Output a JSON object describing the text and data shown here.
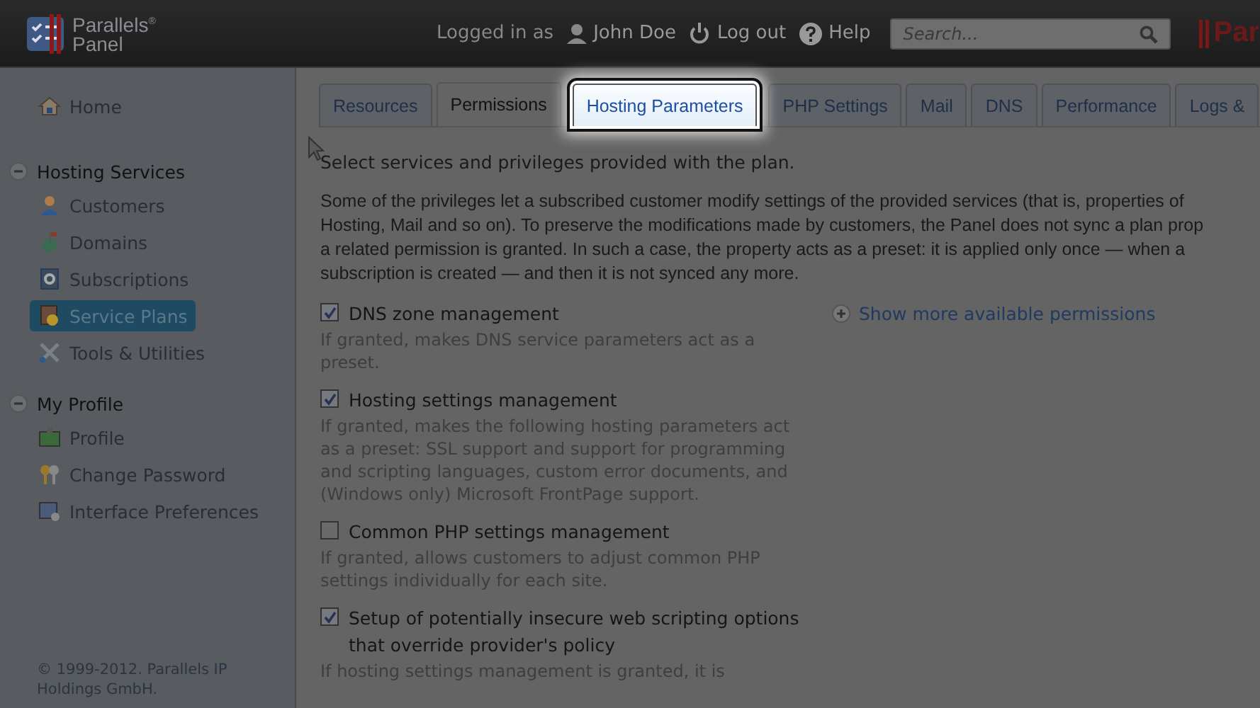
{
  "header": {
    "logo_line_1": "Parallels$^{®}$",
    "logo_line_2": "Panel",
    "logged_in_label": "Logged in as",
    "user_name": "John Doe",
    "logout": "Log out",
    "help": "Help",
    "search": {
      "placeholder": "Search..."
    },
    "brand_cut": "Par"
  },
  "sidebar": {
    "items": [
      {
        "label": "Home",
        "selected": false
      }
    ],
    "sections": [
      {
        "title": "Hosting Services",
        "expanded": true,
        "items": [
          {
            "label": "Customers",
            "selected": false
          },
          {
            "label": "Domains",
            "selected": false
          },
          {
            "label": "Subscriptions",
            "selected": false
          },
          {
            "label": "Service Plans",
            "selected": true
          },
          {
            "label": "Tools & Utilities",
            "selected": false
          }
        ]
      },
      {
        "title": "My Profile",
        "expanded": true,
        "items": [
          {
            "label": "Profile",
            "selected": false
          },
          {
            "label": "Change Password",
            "selected": false
          },
          {
            "label": "Interface Preferences",
            "selected": false
          }
        ]
      }
    ],
    "copyright": "© 1999-2012. Parallels IP Holdings GmbH."
  },
  "tabs": [
    {
      "label": "Resources",
      "selected": false,
      "highlighted": false
    },
    {
      "label": "Permissions",
      "selected": true,
      "highlighted": false
    },
    {
      "label": "Hosting Parameters",
      "selected": false,
      "highlighted": true
    },
    {
      "label": "PHP Settings",
      "selected": false,
      "highlighted": false
    },
    {
      "label": "Mail",
      "selected": false,
      "highlighted": false
    },
    {
      "label": "DNS",
      "selected": false,
      "highlighted": false
    },
    {
      "label": "Performance",
      "selected": false,
      "highlighted": false
    },
    {
      "label": "Logs &",
      "selected": false,
      "highlighted": false
    }
  ],
  "intro": "Select services and privileges provided with the plan.",
  "note_lines": [
    "Some of the privileges let a subscribed customer modify settings of the provided services (that is, properties of",
    "Hosting, Mail and so on). To preserve the modifications made by customers, the Panel does not sync a plan prop",
    "a related permission is granted. In such a case, the property acts as a preset: it is applied only once — when a",
    "subscription is created — and then it is not synced any more."
  ],
  "show_more": "Show more available permissions",
  "permissions": [
    {
      "label": "DNS zone management",
      "checked": true,
      "description": "If granted, makes DNS service parameters act as a preset."
    },
    {
      "label": "Hosting settings management",
      "checked": true,
      "description": "If granted, makes the following hosting parameters act as a preset: SSL support and support for programming and scripting languages, custom error documents, and (Windows only) Microsoft FrontPage support."
    },
    {
      "label": "Common PHP settings management",
      "checked": false,
      "description": "If granted, allows customers to adjust common PHP settings individually for each site."
    },
    {
      "label": "Setup of potentially insecure web scripting options that override provider's policy",
      "checked": true,
      "description": "If hosting settings management is granted, it is"
    }
  ]
}
